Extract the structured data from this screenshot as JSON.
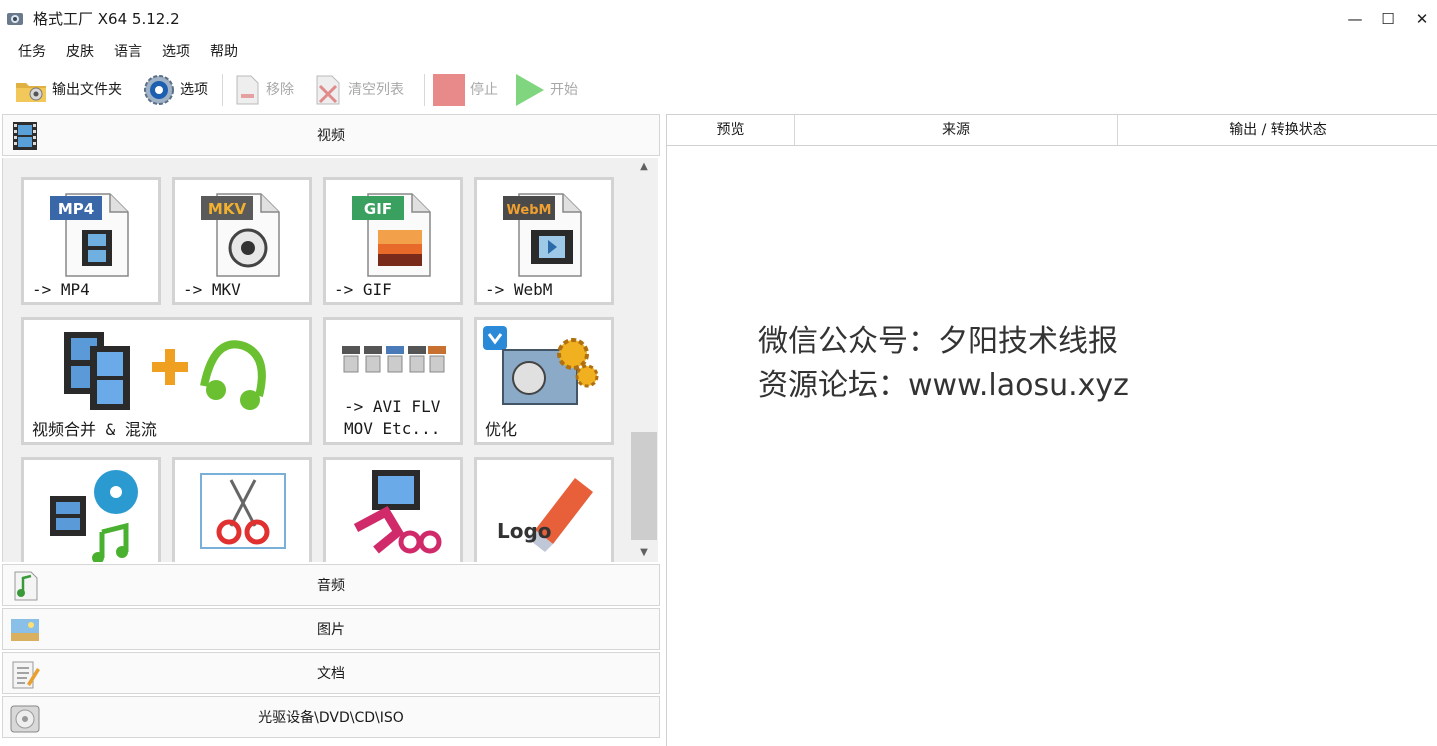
{
  "window": {
    "title": "格式工厂 X64 5.12.2",
    "controls": {
      "minimize": "—",
      "maximize": "☐",
      "close": "✕"
    }
  },
  "menu": [
    "任务",
    "皮肤",
    "语言",
    "选项",
    "帮助"
  ],
  "toolbar": {
    "output_folder": "输出文件夹",
    "options": "选项",
    "remove": "移除",
    "clear_list": "清空列表",
    "stop": "停止",
    "start": "开始"
  },
  "categories": {
    "video": "视频",
    "audio": "音频",
    "image": "图片",
    "document": "文档",
    "disc": "光驱设备\\DVD\\CD\\ISO"
  },
  "tiles": {
    "mp4": {
      "badge": "MP4",
      "label": "-> MP4",
      "badge_color": "#3a67a8"
    },
    "mkv": {
      "badge": "MKV",
      "label": "-> MKV",
      "badge_color": "#5a5a5a"
    },
    "gif": {
      "badge": "GIF",
      "label": "-> GIF",
      "badge_color": "#3aa060"
    },
    "webm": {
      "badge": "WebM",
      "label": "-> WebM",
      "badge_color": "#4a4a4a"
    },
    "merge": {
      "label": "视频合并 & 混流"
    },
    "other": {
      "label": "-> AVI FLV\nMOV Etc..."
    },
    "optimize": {
      "label": "优化"
    },
    "logo_text": "Logo"
  },
  "list_columns": [
    "预览",
    "来源",
    "输出 / 转换状态"
  ],
  "watermark": {
    "line1": "微信公众号：夕阳技术线报",
    "line2": "资源论坛：www.laosu.xyz"
  },
  "colors": {
    "stop_red": "#e88a8a",
    "start_green": "#7fd67f",
    "border": "#d3d3d3"
  }
}
